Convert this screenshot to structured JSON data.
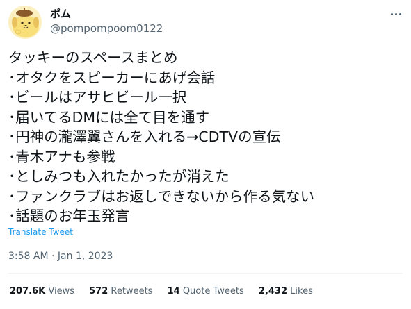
{
  "author": {
    "display_name": "ポム",
    "handle": "@pompompoom0122",
    "avatar_icon": "pompompurin-avatar-icon"
  },
  "menu": {
    "more_icon": "more-options-icon"
  },
  "tweet": {
    "lines": [
      "タッキーのスペースまとめ",
      "･オタクをスピーカーにあげ会話",
      "･ビールはアサヒビール一択",
      "･届いてるDMには全て目を通す",
      "･円神の瀧澤翼さんを入れる→CDTVの宣伝",
      "･青木アナも参戦",
      "･としみつも入れたかったが消えた",
      "･ファンクラブはお返しできないから作る気ない",
      "･話題のお年玉発言"
    ],
    "translate_label": "Translate Tweet",
    "time": "3:58 AM",
    "separator": " · ",
    "date": "Jan 1, 2023"
  },
  "stats": {
    "views": {
      "value": "207.6K",
      "label": "Views"
    },
    "retweets": {
      "value": "572",
      "label": "Retweets"
    },
    "quote_tweets": {
      "value": "14",
      "label": "Quote Tweets"
    },
    "likes": {
      "value": "2,432",
      "label": "Likes"
    }
  },
  "colors": {
    "link": "#1d9bf0",
    "secondary_text": "#536471",
    "primary_text": "#0f1419"
  }
}
